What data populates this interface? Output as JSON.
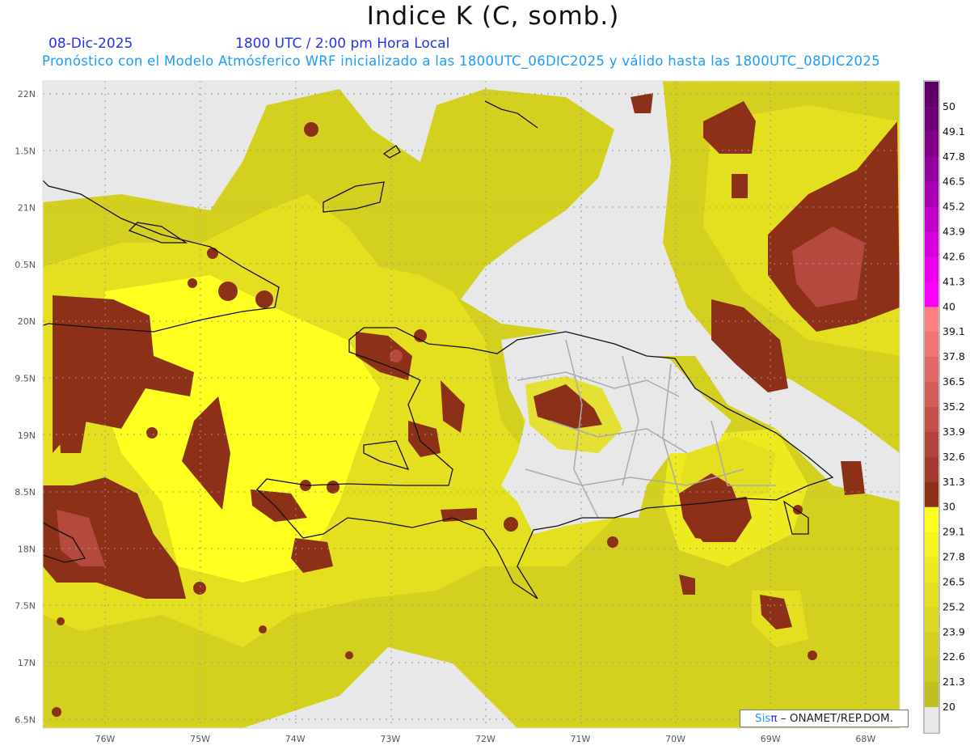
{
  "header": {
    "title": "Indice K (C, somb.)",
    "date": "08-Dic-2025",
    "time": "1800 UTC / 2:00 pm Hora Local",
    "subtitle": "Pronóstico con el Modelo Atmósferico WRF inicializado a las 1800UTC_06DIC2025 y válido hasta las  1800UTC_08DIC2025"
  },
  "axes": {
    "longitude_labels": [
      "76W",
      "75W",
      "74W",
      "73W",
      "72W",
      "71W",
      "70W",
      "69W",
      "68W"
    ],
    "latitude_labels": [
      "22N",
      "1.5N",
      "21N",
      "0.5N",
      "20N",
      "9.5N",
      "19N",
      "8.5N",
      "18N",
      "7.5N",
      "17N",
      "6.5N"
    ]
  },
  "colorbar": {
    "labels": [
      "50",
      "49.1",
      "47.8",
      "46.5",
      "45.2",
      "43.9",
      "42.6",
      "41.3",
      "40",
      "39.1",
      "37.8",
      "36.5",
      "35.2",
      "33.9",
      "32.6",
      "31.3",
      "30",
      "29.1",
      "27.8",
      "26.5",
      "25.2",
      "23.9",
      "22.6",
      "21.3",
      "20"
    ],
    "colors": [
      "#5e0066",
      "#6e0078",
      "#800088",
      "#9400a0",
      "#a800b4",
      "#c000c8",
      "#d800dc",
      "#ec00ec",
      "#ff00ff",
      "#ff8080",
      "#ef7474",
      "#e06868",
      "#d05e58",
      "#c05048",
      "#b0443a",
      "#a03a2c",
      "#8c3018",
      "#ffff20",
      "#f8f420",
      "#eeea20",
      "#e4e020",
      "#dcd820",
      "#d4d020",
      "#cccb20",
      "#c0c020",
      "#e8e8e8"
    ]
  },
  "credit": {
    "logo_sis": "Sis",
    "logo_pi": "π",
    "text": " – ONAMET/REP.DOM."
  }
}
